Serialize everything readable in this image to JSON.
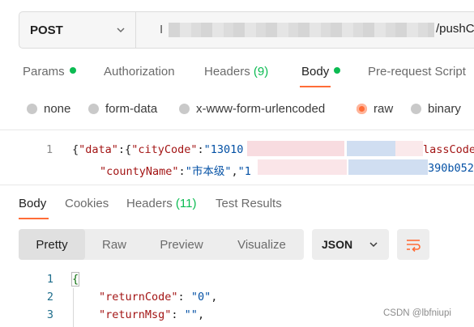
{
  "request": {
    "method": "POST",
    "url_tail": "/pushC"
  },
  "request_tabs": {
    "params": "Params",
    "authorization": "Authorization",
    "headers": "Headers",
    "headers_count": "(9)",
    "body": "Body",
    "prerequest": "Pre-request Script"
  },
  "body_types": [
    "none",
    "form-data",
    "x-www-form-urlencoded",
    "raw",
    "binary"
  ],
  "request_body": {
    "line_number": "1",
    "line1": {
      "brace": "{",
      "key1": "\"data\"",
      "colon1": ":{",
      "key2": "\"cityCode\"",
      "colon2": ":",
      "val_partial": "\"13010",
      "tail": "lassCode"
    },
    "line2": {
      "key": "\"countyName\"",
      "colon": ":",
      "val": "\"市本级\"",
      "comma": ",",
      "cut": "\"1",
      "tail": "390b052"
    }
  },
  "response_tabs": {
    "body": "Body",
    "cookies": "Cookies",
    "headers": "Headers",
    "headers_count": "(11)",
    "test_results": "Test Results"
  },
  "view_modes": [
    "Pretty",
    "Raw",
    "Preview",
    "Visualize"
  ],
  "format": "JSON",
  "response_body": [
    {
      "n": "1",
      "text": "{"
    },
    {
      "n": "2",
      "key": "\"returnCode\"",
      "sep": ": ",
      "val": "\"0\"",
      "end": ","
    },
    {
      "n": "3",
      "key": "\"returnMsg\"",
      "sep": ": ",
      "val": "\"\"",
      "end": ","
    }
  ],
  "watermark": "CSDN @lbfniupi",
  "colors": {
    "accent": "#ff6c37",
    "status_green": "#0cbb52",
    "json_key": "#a31515",
    "json_string": "#0451a5"
  }
}
